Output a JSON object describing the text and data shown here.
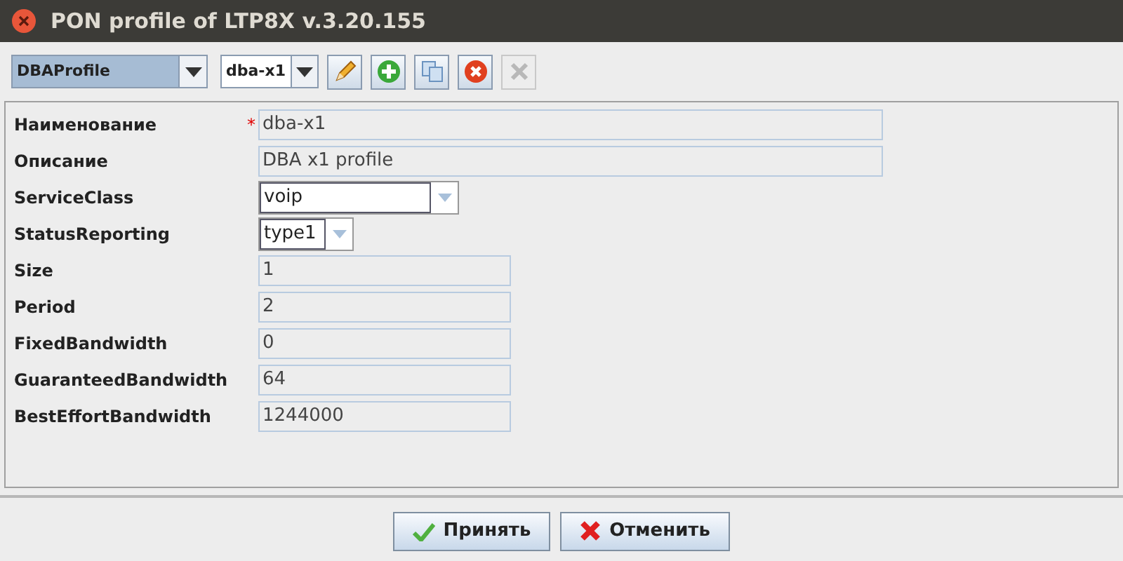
{
  "window": {
    "title": "PON profile of LTP8X v.3.20.155"
  },
  "toolbar": {
    "combos": [
      {
        "value": "DBAProfile",
        "selected": true
      },
      {
        "value": "dba-x1",
        "selected": false
      }
    ],
    "buttons": [
      {
        "kind": "edit",
        "disabled": false
      },
      {
        "kind": "add",
        "disabled": false
      },
      {
        "kind": "copy",
        "disabled": false
      },
      {
        "kind": "delete",
        "disabled": false
      },
      {
        "kind": "remove",
        "disabled": true
      }
    ]
  },
  "fields": [
    {
      "label": "Наименование",
      "kind": "text",
      "marker": "*",
      "value": "dba-x1"
    },
    {
      "label": "Описание",
      "kind": "text",
      "value": "DBA x1 profile"
    },
    {
      "label": "ServiceClass",
      "kind": "combo",
      "value": "voip"
    },
    {
      "label": "StatusReporting",
      "kind": "combo",
      "value": "type1"
    },
    {
      "label": "Size",
      "kind": "text",
      "value": "1"
    },
    {
      "label": "Period",
      "kind": "text",
      "value": "2"
    },
    {
      "label": "FixedBandwidth",
      "kind": "text",
      "value": "0"
    },
    {
      "label": "GuaranteedBandwidth",
      "kind": "text",
      "value": "64"
    },
    {
      "label": "BestEffortBandwidth",
      "kind": "text",
      "value": "1244000"
    }
  ],
  "buttons": [
    {
      "kind": "accept",
      "label": "Принять"
    },
    {
      "kind": "cancel",
      "label": "Отменить"
    }
  ]
}
